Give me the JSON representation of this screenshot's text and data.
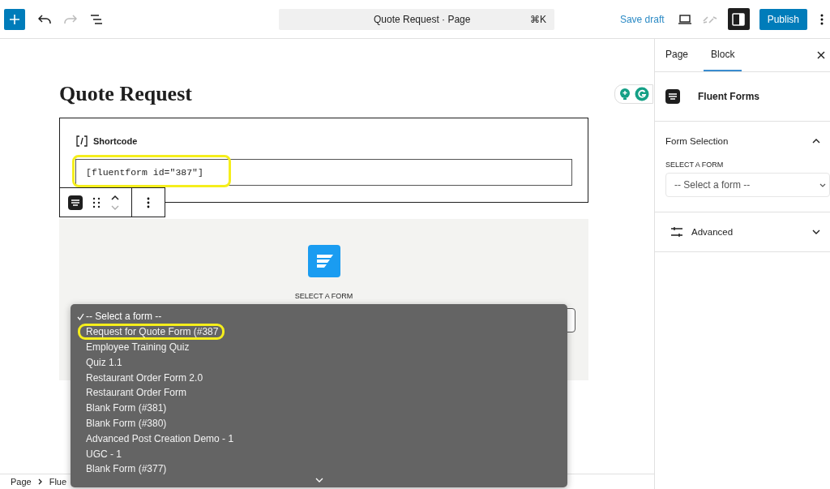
{
  "toolbar": {
    "document_title": "Quote Request · Page",
    "shortcut": "⌘K",
    "save_draft": "Save draft",
    "publish": "Publish",
    "sidebar_open": true
  },
  "editor": {
    "title": "Quote Request",
    "shortcode_block": {
      "label": "Shortcode",
      "value": "[fluentform id=\"387\"]",
      "annotated": true
    },
    "form_block": {
      "label": "SELECT A FORM"
    },
    "dropdown": {
      "options": [
        {
          "label": "-- Select a form --",
          "selected": true,
          "annotated": false
        },
        {
          "label": "Request for Quote Form (#387",
          "selected": false,
          "annotated": true
        },
        {
          "label": "Employee Training Quiz",
          "selected": false,
          "annotated": false
        },
        {
          "label": "Quiz 1.1",
          "selected": false,
          "annotated": false
        },
        {
          "label": "Restaurant Order Form 2.0",
          "selected": false,
          "annotated": false
        },
        {
          "label": "Restaurant Order Form",
          "selected": false,
          "annotated": false
        },
        {
          "label": "Blank Form (#381)",
          "selected": false,
          "annotated": false
        },
        {
          "label": "Blank Form (#380)",
          "selected": false,
          "annotated": false
        },
        {
          "label": "Advanced Post Creation Demo - 1",
          "selected": false,
          "annotated": false
        },
        {
          "label": "UGC - 1",
          "selected": false,
          "annotated": false
        },
        {
          "label": "Blank Form (#377)",
          "selected": false,
          "annotated": false
        }
      ]
    }
  },
  "breadcrumb": [
    "Page",
    "Flue"
  ],
  "sidebar": {
    "tabs": [
      {
        "label": "Page",
        "selected": false
      },
      {
        "label": "Block",
        "selected": true
      }
    ],
    "block_name": "Fluent Forms",
    "panels": [
      {
        "title": "Form Selection",
        "expanded": true,
        "has_icon": false,
        "field_label": "SELECT A FORM",
        "select_value": "-- Select a form --"
      },
      {
        "title": "Advanced",
        "expanded": false,
        "has_icon": true
      }
    ]
  }
}
